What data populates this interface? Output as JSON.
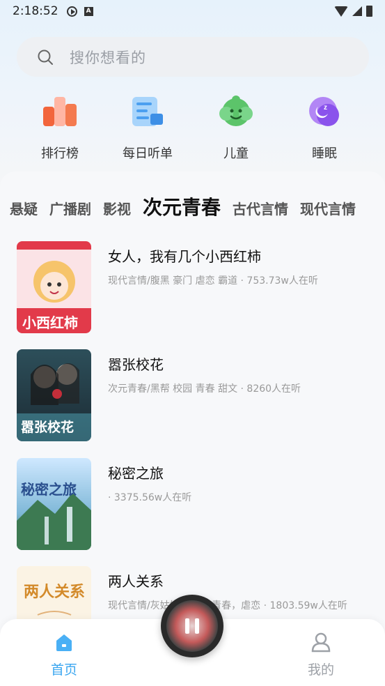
{
  "status_bar": {
    "time": "2:18:52",
    "a_icon_letter": "A"
  },
  "search": {
    "placeholder": "搜你想看的",
    "icon": "search-icon"
  },
  "quick_entries": [
    {
      "label": "排行榜",
      "icon": "ranking-icon",
      "color": "#f2653c"
    },
    {
      "label": "每日听单",
      "icon": "daily-list-icon",
      "color": "#4b9ff0"
    },
    {
      "label": "儿童",
      "icon": "kids-icon",
      "color": "#5cc46a"
    },
    {
      "label": "睡眠",
      "icon": "sleep-icon",
      "color": "#9a5ff0"
    }
  ],
  "category_tabs": [
    {
      "label": "悬疑",
      "active": false
    },
    {
      "label": "广播剧",
      "active": false
    },
    {
      "label": "影视",
      "active": false
    },
    {
      "label": "次元青春",
      "active": true
    },
    {
      "label": "古代言情",
      "active": false
    },
    {
      "label": "现代言情",
      "active": false
    }
  ],
  "books": [
    {
      "title": "女人，我有几个小西红柿",
      "meta": "现代言情/腹黑 豪门 虐恋 霸道 · 753.73w人在听",
      "cover_text": "小西红柿"
    },
    {
      "title": "嚣张校花",
      "meta": "次元青春/黑帮 校园 青春 甜文 · 8260人在听",
      "cover_text": "嚣张校花"
    },
    {
      "title": "秘密之旅",
      "meta": " · 3375.56w人在听",
      "cover_text": "秘密之旅"
    },
    {
      "title": "两人关系",
      "meta": "现代言情/灰姑娘 豪门，青春，虐恋 · 1803.59w人在听",
      "cover_text": "两人关系"
    }
  ],
  "bottom_nav": {
    "home": {
      "label": "首页",
      "active": true,
      "color": "#3aa6f0"
    },
    "me": {
      "label": "我的",
      "active": false,
      "color": "#9da1a7"
    }
  },
  "player": {
    "state": "playing",
    "icon": "pause-icon"
  }
}
